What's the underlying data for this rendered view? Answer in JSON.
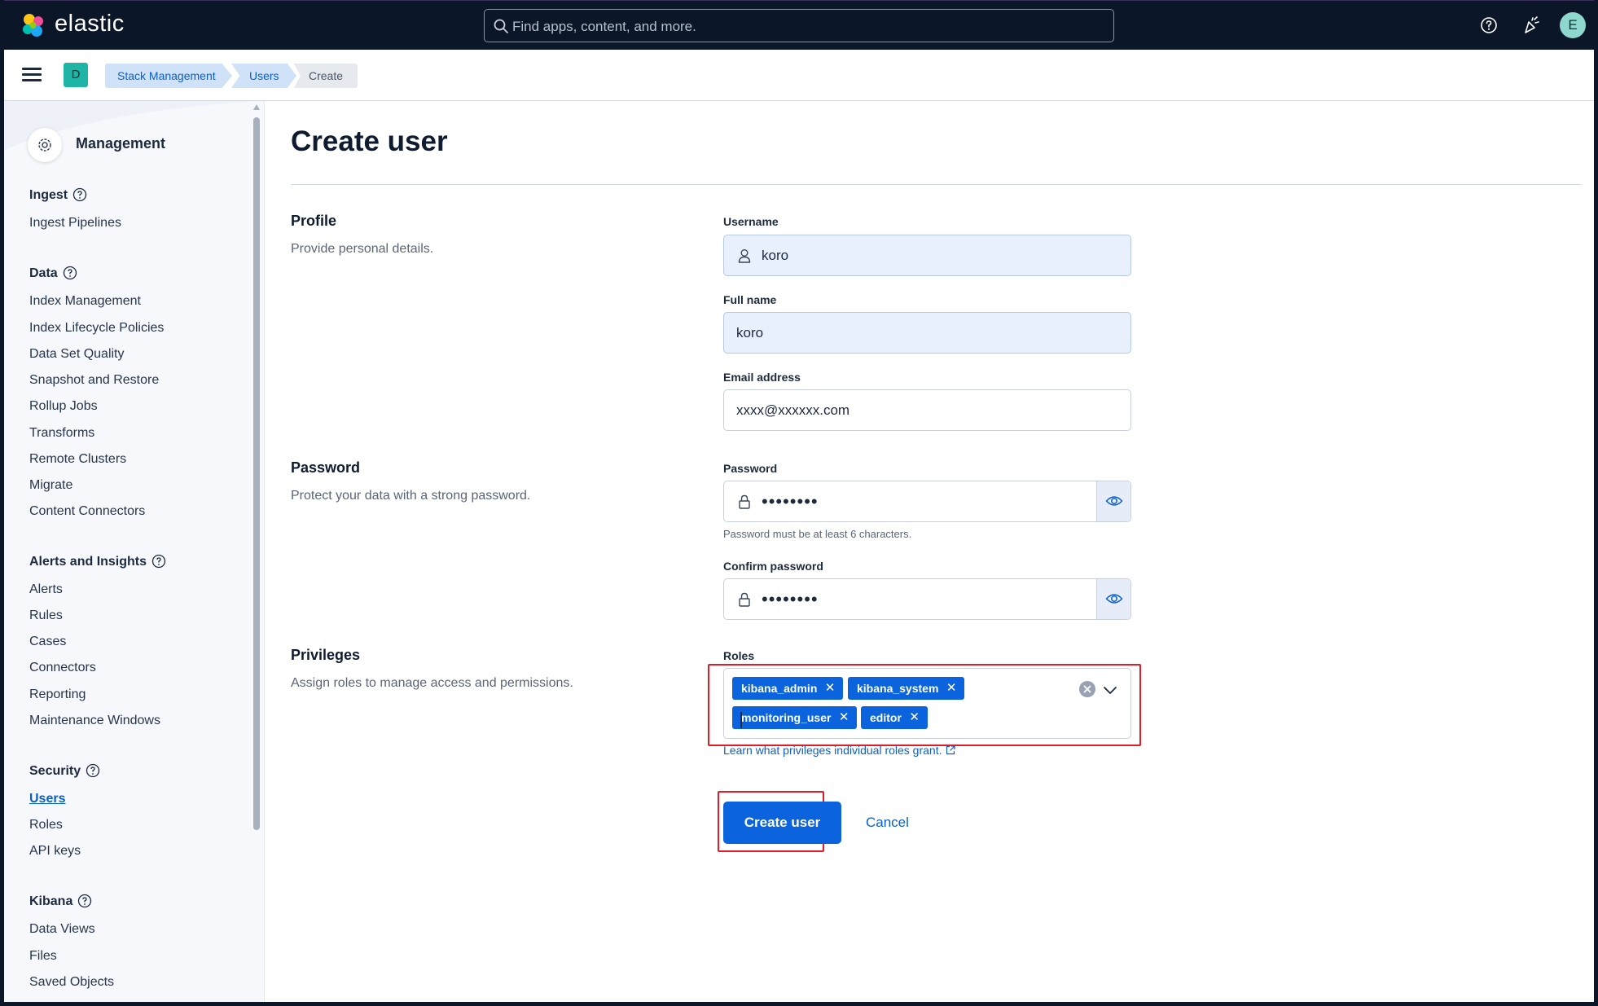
{
  "header": {
    "brand": "elastic",
    "search_placeholder": "Find apps, content, and more.",
    "avatar_initial": "E"
  },
  "breadcrumbs": {
    "space_initial": "D",
    "items": [
      "Stack Management",
      "Users",
      "Create"
    ]
  },
  "sidebar": {
    "title": "Management",
    "groups": [
      {
        "label": "Ingest",
        "items": [
          "Ingest Pipelines"
        ]
      },
      {
        "label": "Data",
        "items": [
          "Index Management",
          "Index Lifecycle Policies",
          "Data Set Quality",
          "Snapshot and Restore",
          "Rollup Jobs",
          "Transforms",
          "Remote Clusters",
          "Migrate",
          "Content Connectors"
        ]
      },
      {
        "label": "Alerts and Insights",
        "items": [
          "Alerts",
          "Rules",
          "Cases",
          "Connectors",
          "Reporting",
          "Maintenance Windows"
        ]
      },
      {
        "label": "Security",
        "items": [
          "Users",
          "Roles",
          "API keys"
        ]
      },
      {
        "label": "Kibana",
        "items": [
          "Data Views",
          "Files",
          "Saved Objects"
        ]
      }
    ],
    "active_item": "Users"
  },
  "main": {
    "title": "Create user",
    "profile": {
      "title": "Profile",
      "description": "Provide personal details.",
      "username_label": "Username",
      "username_value": "koro",
      "fullname_label": "Full name",
      "fullname_value": "koro",
      "email_label": "Email address",
      "email_value": "xxxx@xxxxxx.com"
    },
    "password": {
      "title": "Password",
      "description": "Protect your data with a strong password.",
      "password_label": "Password",
      "password_mask": "••••••••",
      "password_help": "Password must be at least 6 characters.",
      "confirm_label": "Confirm password",
      "confirm_mask": "••••••••"
    },
    "privileges": {
      "title": "Privileges",
      "description": "Assign roles to manage access and permissions.",
      "roles_label": "Roles",
      "roles": [
        "kibana_admin",
        "kibana_system",
        "monitoring_user",
        "editor"
      ],
      "learn_link": "Learn what privileges individual roles grant."
    },
    "actions": {
      "create_label": "Create user",
      "cancel_label": "Cancel"
    }
  },
  "colors": {
    "header_bg": "#0b1628",
    "primary": "#0b64dd",
    "highlight": "#e11d2a"
  }
}
